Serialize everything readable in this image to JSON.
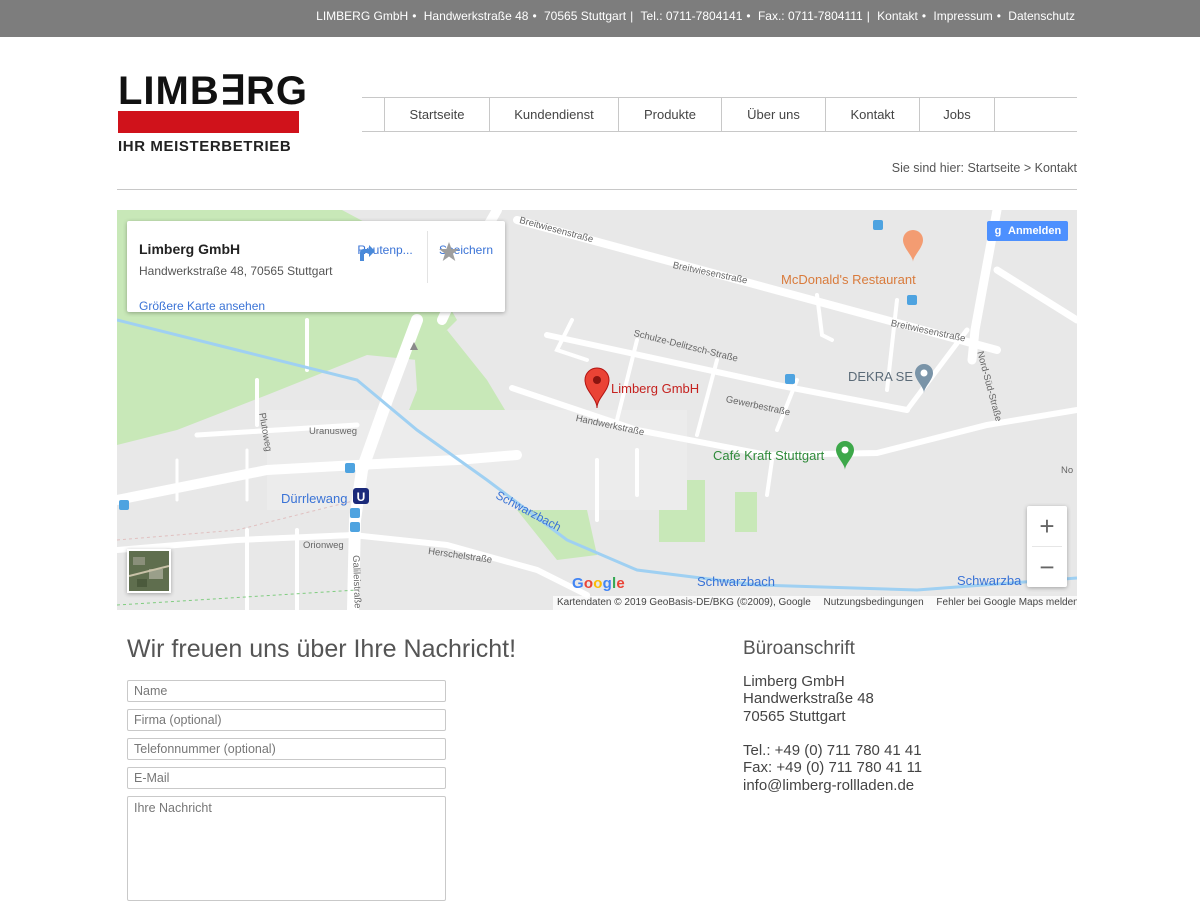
{
  "topbar": {
    "company": "LIMBERG GmbH",
    "street": "Handwerkstraße 48",
    "city": "70565 Stuttgart",
    "tel": "Tel.: 0711-7804141",
    "fax": "Fax.: 0711-7804111",
    "links": [
      "Kontakt",
      "Impressum",
      "Datenschutz"
    ]
  },
  "logo": {
    "word": "LIMB∃RG",
    "tagline": "IHR MEISTERBETRIEB",
    "brand_color": "#d0121b"
  },
  "nav": {
    "items": [
      "Startseite",
      "Kundendienst",
      "Produkte",
      "Über uns",
      "Kontakt",
      "Jobs"
    ]
  },
  "breadcrumb": {
    "prefix": "Sie sind hier:",
    "home": "Startseite",
    "separator": ">",
    "current": "Kontakt"
  },
  "map": {
    "card": {
      "name": "Limberg GmbH",
      "address": "Handwerkstraße 48, 70565 Stuttgart",
      "route_label": "Routenp...",
      "save_label": "Speichern",
      "bigger_map": "Größere Karte ansehen"
    },
    "signin": "Anmelden",
    "pois": {
      "limberg": "Limberg GmbH",
      "mcdonalds": "McDonald's Restaurant",
      "dekra": "DEKRA SE",
      "cafe": "Café Kraft Stuttgart",
      "station": "Dürrlewang",
      "stream1": "Schwarzbach",
      "stream2": "Schwarzbach",
      "stream3": "Schwarzba"
    },
    "streets": {
      "breitwiesen1": "Breitwiesenstraße",
      "breitwiesen2": "Breitwiesenstraße",
      "breitwiesen3": "Breitwiesenstraße",
      "schulze": "Schulze-Delitzsch-Straße",
      "gewerbe": "Gewerbestraße",
      "handwerk": "Handwerkstraße",
      "nordsued": "Nord-Süd-Straße",
      "uranus": "Uranusweg",
      "pluto": "Plutoweg",
      "orion": "Orionweg",
      "herschel": "Herschelstraße",
      "galilei": "Galileistraße",
      "no": "No"
    },
    "zoom_in": "+",
    "zoom_out": "−",
    "google": [
      "G",
      "o",
      "o",
      "g",
      "l",
      "e"
    ],
    "attribution": "Kartendaten © 2019 GeoBasis-DE/BKG (©2009), Google",
    "terms": "Nutzungsbedingungen",
    "report": "Fehler bei Google Maps melden"
  },
  "form": {
    "title": "Wir freuen uns über Ihre Nachricht!",
    "name_placeholder": "Name",
    "company_placeholder": "Firma (optional)",
    "phone_placeholder": "Telefonnummer (optional)",
    "email_placeholder": "E-Mail",
    "message_placeholder": "Ihre Nachricht"
  },
  "office": {
    "title": "Büroanschrift",
    "company": "Limberg GmbH",
    "street": "Handwerkstraße 48",
    "city": "70565 Stuttgart",
    "tel": "Tel.: +49 (0) 711 780 41 41",
    "fax": "Fax: +49 (0) 711 780 41 11",
    "email": "info@limberg-rollladen.de"
  }
}
